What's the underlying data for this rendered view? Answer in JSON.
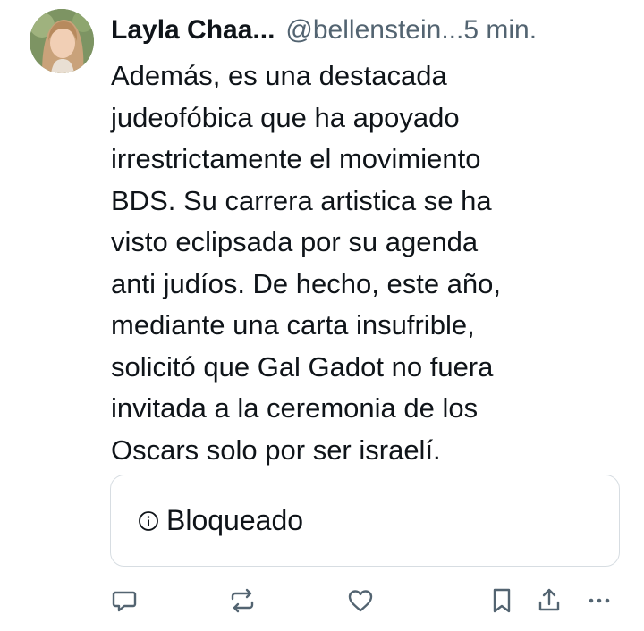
{
  "post": {
    "author_name": "Layla Chaa...",
    "handle": "@bellenstein...",
    "time": "5 min.",
    "lines": [
      "Además, es una destacada",
      "judeofóbica que ha apoyado",
      "irrestrictamente el movimiento",
      "BDS. Su carrera artistica se ha",
      "visto eclipsada por su agenda",
      "anti judíos. De hecho, este año,",
      "mediante una carta insufrible,",
      "solicitó que Gal Gadot no fuera",
      "invitada a la ceremonia de los",
      "Oscars solo por ser israelí."
    ],
    "blocked_label": "Bloqueado"
  },
  "icons": {
    "avatar": "avatar-photo",
    "info": "info-icon",
    "reply": "reply-icon",
    "retweet": "retweet-icon",
    "like": "heart-icon",
    "bookmark": "bookmark-icon",
    "share": "share-icon",
    "more": "more-icon"
  },
  "colors": {
    "text": "#0f1419",
    "secondary": "#536471",
    "border": "#d7dde2"
  }
}
